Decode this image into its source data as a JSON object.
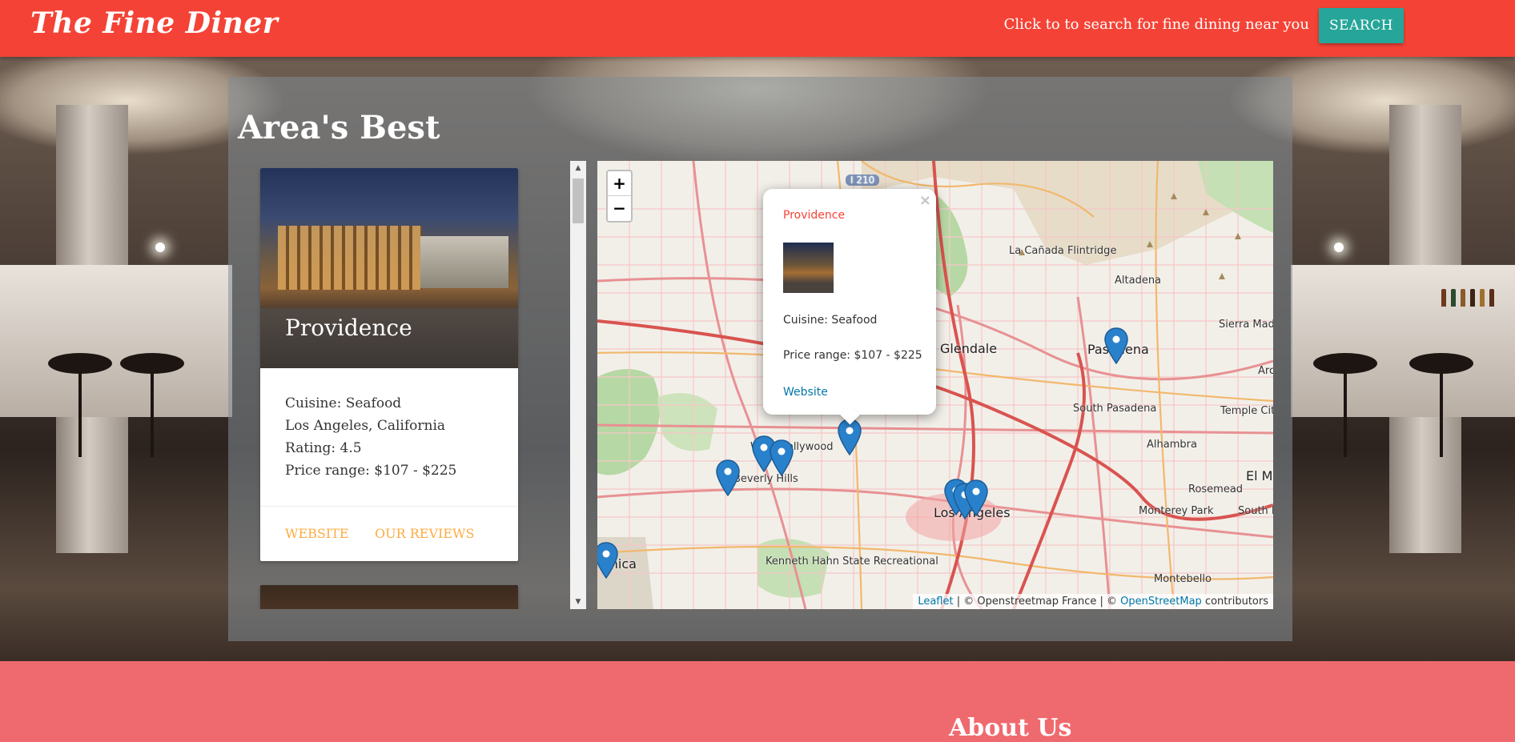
{
  "header": {
    "brand": "The Fine Diner",
    "prompt_text": "Click to to search for fine dining near you",
    "search_label": "SEARCH"
  },
  "section": {
    "title": "Area's Best"
  },
  "restaurant_card": {
    "name": "Providence",
    "cuisine": "Cuisine: Seafood",
    "location": "Los Angeles, California",
    "rating": "Rating: 4.5",
    "price_range": "Price range: $107 - $225",
    "website_label": "WEBSITE",
    "reviews_label": "OUR REVIEWS"
  },
  "map": {
    "zoom_in": "+",
    "zoom_out": "−",
    "place_labels": [
      "La Cañada Flintridge",
      "Altadena",
      "Glendale",
      "Pasadena",
      "Sierra Mad",
      "South Pasadena",
      "Temple City",
      "Alhambra",
      "El M",
      "Rosemead",
      "Monterey Park",
      "South Mont",
      "West Hollywood",
      "Beverly Hills",
      "Los Angeles",
      "Montebello",
      "Kenneth Hahn State Recreational",
      "onica",
      "Arc",
      "I 210"
    ],
    "popup": {
      "close": "×",
      "name": "Providence",
      "cuisine": "Cuisine: Seafood",
      "price_range": "Price range: $107 - $225",
      "website_label": "Website"
    },
    "attribution": {
      "leaflet": "Leaflet",
      "osm_france": " | © Openstreetmap France | © ",
      "osm": "OpenStreetMap",
      "contributors": " contributors"
    }
  },
  "footer": {
    "about_title": "About Us"
  },
  "colors": {
    "header_red": "#f44336",
    "search_teal": "#26a69a",
    "link_orange": "#ffab40",
    "footer_pink": "#ef6a6f",
    "marker_blue": "#2a81cb"
  }
}
